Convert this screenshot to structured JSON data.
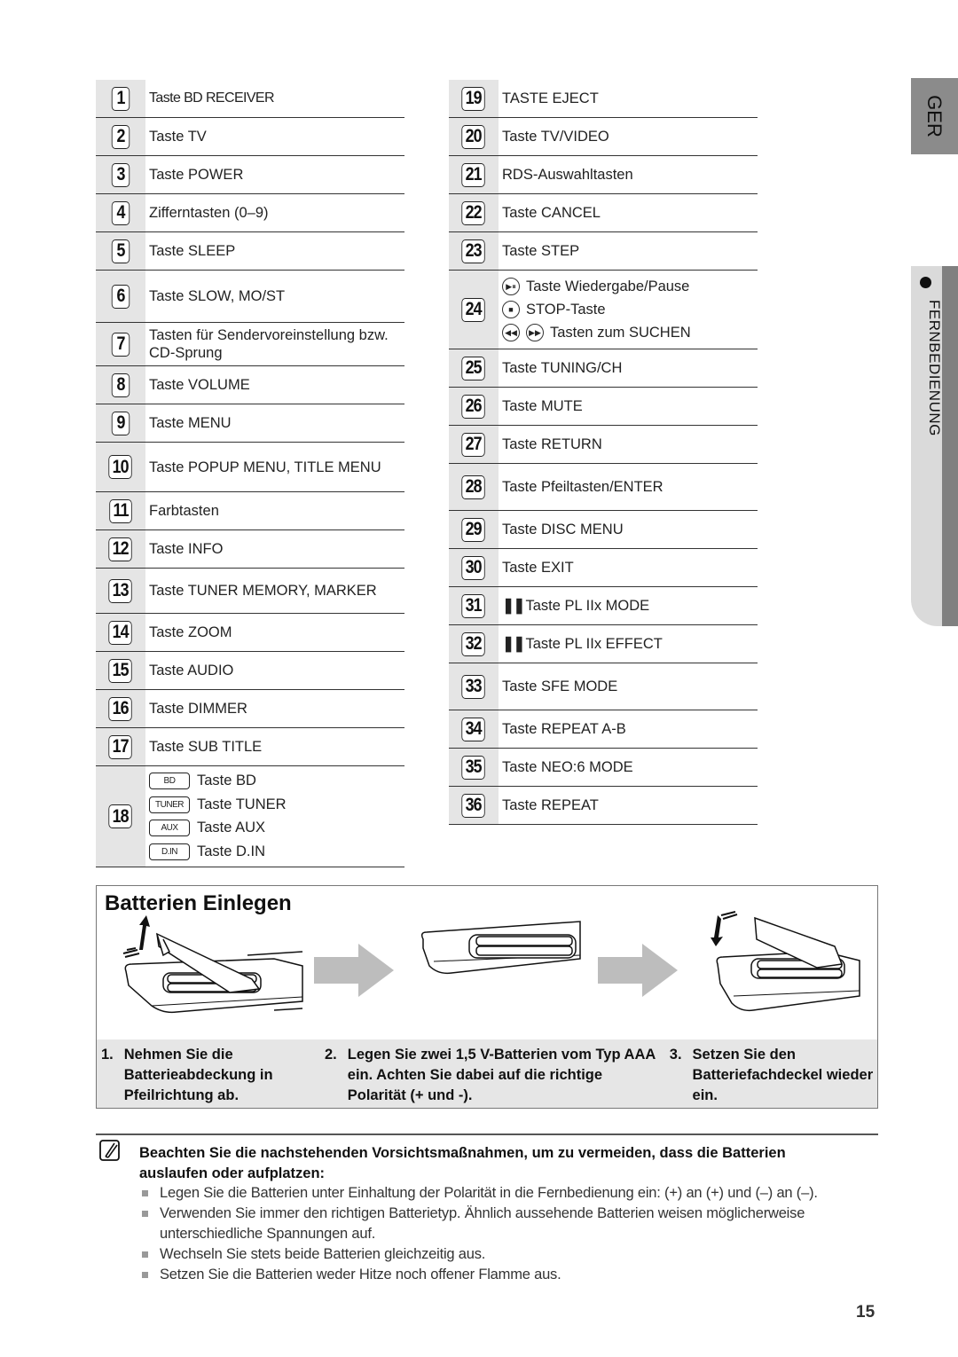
{
  "side_tabs": {
    "language": "GER",
    "section": "FERNBEDIENUNG"
  },
  "left_column": [
    {
      "num": "1",
      "label": "Taste BD RECEIVER",
      "narrow": true
    },
    {
      "num": "2",
      "label": "Taste TV"
    },
    {
      "num": "3",
      "label": "Taste POWER"
    },
    {
      "num": "4",
      "label": "Zifferntasten (0–9)"
    },
    {
      "num": "5",
      "label": "Taste SLEEP"
    },
    {
      "num": "6",
      "label": "Taste SLOW, MO/ST"
    },
    {
      "num": "7",
      "label": "Tasten für Sendervoreinstellung bzw. CD-Sprung"
    },
    {
      "num": "8",
      "label": "Taste VOLUME"
    },
    {
      "num": "9",
      "label": "Taste MENU"
    },
    {
      "num": "10",
      "label": "Taste POPUP MENU, TITLE MENU"
    },
    {
      "num": "11",
      "label": "Farbtasten"
    },
    {
      "num": "12",
      "label": "Taste INFO"
    },
    {
      "num": "13",
      "label": "Taste TUNER MEMORY, MARKER"
    },
    {
      "num": "14",
      "label": "Taste ZOOM"
    },
    {
      "num": "15",
      "label": "Taste AUDIO"
    },
    {
      "num": "16",
      "label": "Taste DIMMER"
    },
    {
      "num": "17",
      "label": "Taste SUB TITLE"
    }
  ],
  "row18": {
    "num": "18",
    "items": [
      {
        "button": "BD",
        "label": "Taste BD"
      },
      {
        "button": "TUNER",
        "label": "Taste TUNER"
      },
      {
        "button": "AUX",
        "label": "Taste AUX"
      },
      {
        "button": "D.IN",
        "label": "Taste D.IN"
      }
    ]
  },
  "right_column_a": [
    {
      "num": "19",
      "label": "TASTE EJECT"
    },
    {
      "num": "20",
      "label": "Taste TV/VIDEO"
    },
    {
      "num": "21",
      "label": "RDS-Auswahltasten"
    },
    {
      "num": "22",
      "label": "Taste CANCEL"
    },
    {
      "num": "23",
      "label": "Taste STEP"
    }
  ],
  "row24": {
    "num": "24",
    "items": [
      {
        "icons": [
          "▶⏸"
        ],
        "label": "Taste Wiedergabe/Pause"
      },
      {
        "icons": [
          "■"
        ],
        "label": "STOP-Taste"
      },
      {
        "icons": [
          "◀◀",
          "▶▶"
        ],
        "label": "Tasten zum SUCHEN"
      }
    ]
  },
  "right_column_b": [
    {
      "num": "25",
      "label": "Taste TUNING/CH"
    },
    {
      "num": "26",
      "label": "Taste MUTE"
    },
    {
      "num": "27",
      "label": "Taste RETURN"
    },
    {
      "num": "28",
      "label": "Taste Pfeiltasten/ENTER"
    },
    {
      "num": "29",
      "label": "Taste DISC MENU"
    },
    {
      "num": "30",
      "label": "Taste EXIT"
    },
    {
      "num": "31",
      "label": "Taste PL IIx MODE",
      "dolby": true
    },
    {
      "num": "32",
      "label": "Taste PL IIx EFFECT",
      "dolby": true
    },
    {
      "num": "33",
      "label": "Taste SFE MODE"
    },
    {
      "num": "34",
      "label": "Taste REPEAT A-B"
    },
    {
      "num": "35",
      "label": "Taste NEO:6 MODE"
    },
    {
      "num": "36",
      "label": "Taste REPEAT"
    }
  ],
  "battery": {
    "title": "Batterien Einlegen",
    "steps": [
      {
        "n": "1.",
        "text": "Nehmen Sie die Batterieabdeckung in Pfeilrichtung ab."
      },
      {
        "n": "2.",
        "text": "Legen Sie zwei 1,5 V-Batterien vom Typ AAA ein. Achten Sie dabei auf die richtige Polarität (+ und -)."
      },
      {
        "n": "3.",
        "text": "Setzen Sie den Batteriefachdeckel wieder ein."
      }
    ]
  },
  "note": {
    "heading": "Beachten Sie die nachstehenden Vorsichtsmaßnahmen, um zu vermeiden, dass die Batterien auslaufen oder aufplatzen:",
    "items": [
      "Legen Sie die Batterien unter Einhaltung der Polarität in die Fernbedienung ein: (+) an (+) und (–) an (–).",
      "Verwenden Sie immer den richtigen Batterietyp. Ähnlich aussehende Batterien weisen möglicherweise unterschiedliche Spannungen auf.",
      "Wechseln Sie stets beide Batterien gleichzeitig aus.",
      "Setzen Sie die Batterien weder Hitze noch offener Flamme aus."
    ]
  },
  "page_number": "15"
}
